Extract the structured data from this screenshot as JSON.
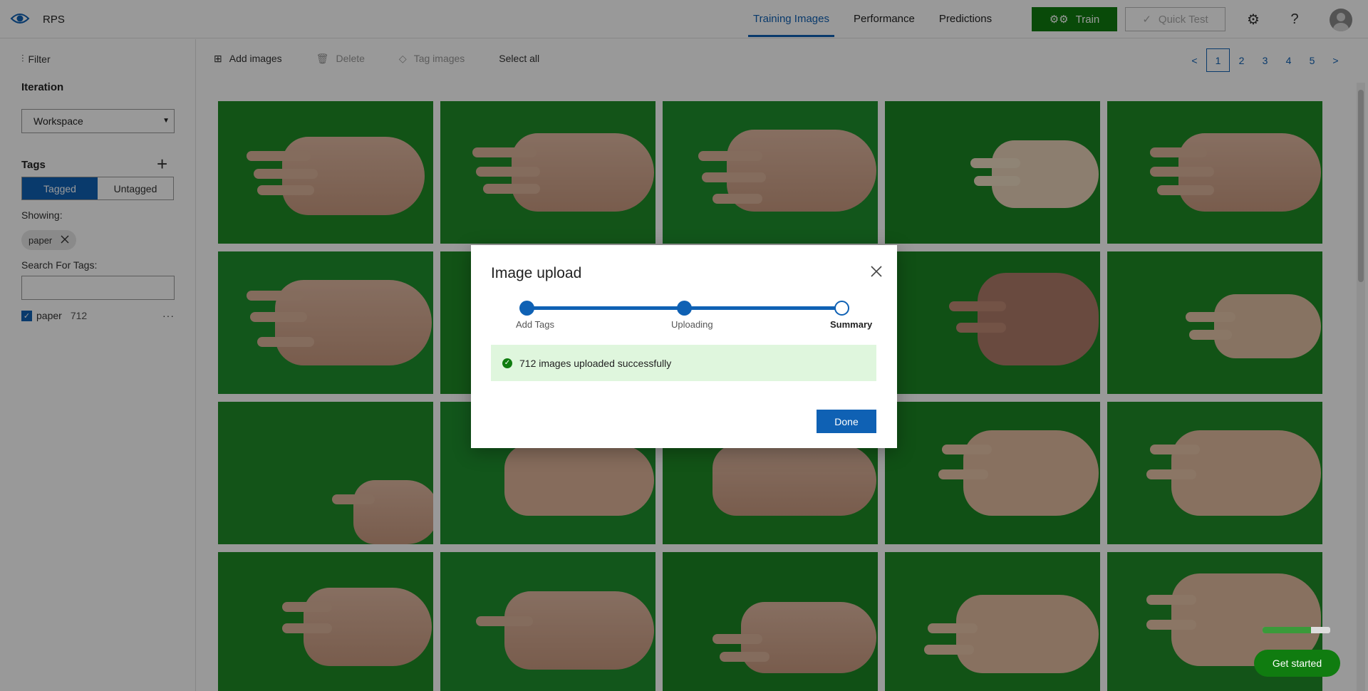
{
  "app": {
    "project_name": "RPS"
  },
  "header": {
    "tabs": [
      {
        "label": "Training Images",
        "active": true
      },
      {
        "label": "Performance",
        "active": false
      },
      {
        "label": "Predictions",
        "active": false
      }
    ],
    "train_label": "Train",
    "quick_test_label": "Quick Test",
    "icons": [
      "eye-icon",
      "gear-icon",
      "help-icon",
      "user-avatar"
    ]
  },
  "sidebar": {
    "filter_label": "Filter",
    "iteration_label": "Iteration",
    "iteration_value": "Workspace",
    "tags_label": "Tags",
    "tagged_label": "Tagged",
    "untagged_label": "Untagged",
    "showing_label": "Showing:",
    "active_chip": "paper",
    "search_label": "Search For Tags:",
    "search_value": "",
    "tag_list": [
      {
        "name": "paper",
        "count": "712",
        "checked": true
      }
    ]
  },
  "toolbar": {
    "add_images": "Add images",
    "delete": "Delete",
    "tag_images": "Tag images",
    "select_all": "Select all"
  },
  "pager": {
    "prev": "<",
    "pages": [
      "1",
      "2",
      "3",
      "4",
      "5"
    ],
    "current": "1",
    "next": ">"
  },
  "modal": {
    "title": "Image upload",
    "steps": [
      {
        "label": "Add Tags",
        "state": "complete"
      },
      {
        "label": "Uploading",
        "state": "complete"
      },
      {
        "label": "Summary",
        "state": "current"
      }
    ],
    "success_message": "712 images uploaded successfully",
    "done_label": "Done"
  },
  "get_started": {
    "label": "Get started",
    "progress": 0.72
  },
  "colors": {
    "accent": "#0f61b4",
    "train": "#107c10",
    "success_bg": "#dff6dd",
    "image_bg": "#1f8b26"
  }
}
